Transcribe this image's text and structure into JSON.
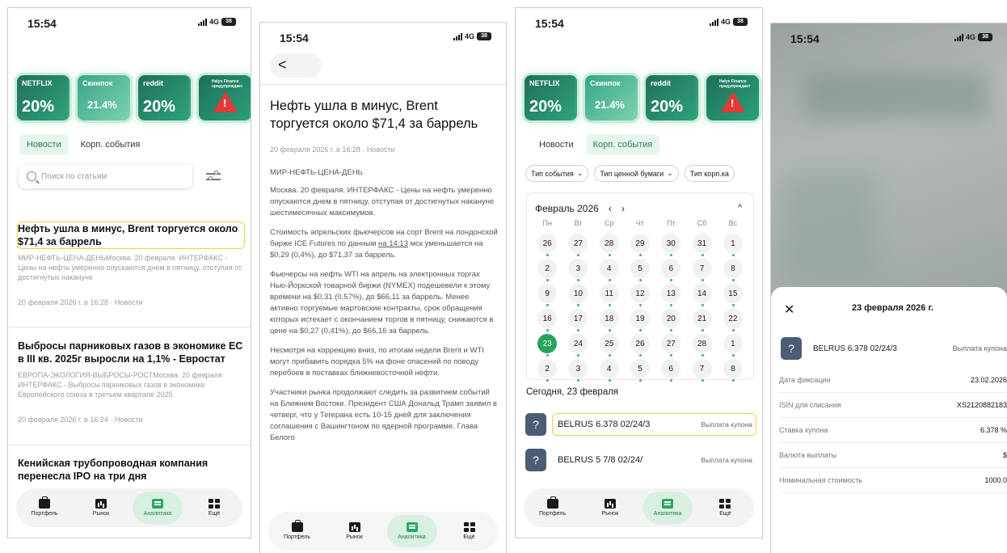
{
  "status": {
    "time": "15:54",
    "network": "4G",
    "battery": "38"
  },
  "promos": [
    {
      "brand": "NETFLIX",
      "value": "20%"
    },
    {
      "brand": "Cкинпок",
      "value": "21.4%"
    },
    {
      "brand": "reddit",
      "value": "20%"
    },
    {
      "brand": "Halys Finance предупреждает"
    }
  ],
  "tabs": {
    "news": "Новости",
    "corp": "Корп. события"
  },
  "search": {
    "placeholder": "Поиск по статьям"
  },
  "news": [
    {
      "title": "Нефть ушла в минус, Brent торгуется около $71,4 за баррель",
      "summary": "МИР-НЕФТЬ-ЦЕНА-ДЕНЬМосква. 20 февраля. ИНТЕРФАКС - Цены на нефть умеренно опускаются днем в пятницу, отступая от достигнутых накануне",
      "date": "20 февраля 2026 г. в 16:28 · Новости"
    },
    {
      "title": "Выбросы парниковых газов в экономике ЕС в III кв. 2025г выросли на 1,1% - Евростат",
      "summary": "ЕВРОПА-ЭКОЛОГИЯ-ВЫБРОСЫ-РОСТМосква. 20 февраля. ИНТЕРФАКС - Выбросы парниковых газов в экономике Европейского союза в третьем квартале 2025",
      "date": "20 февраля 2026 г. в 16:24 · Новости"
    },
    {
      "title": "Кенийская трубопроводная компания перенесла IPO на три дня"
    }
  ],
  "nav": {
    "portfolio": "Портфель",
    "market": "Рынок",
    "analytics": "Аналитика",
    "more": "Ещё"
  },
  "article": {
    "back": "<",
    "title": "Нефть ушла в минус, Brent торгуется около $71,4 за баррель",
    "meta": "20 февраля 2026 г. в 16:28 · Новости",
    "tag": "МИР-НЕФТЬ-ЦЕНА-ДЕНЬ",
    "p1": "Москва. 20 февраля. ИНТЕРФАКС - Цены на нефть умеренно опускаются днем в пятницу, отступая от достигнутых накануне шестимесячных максимумов.",
    "p2a": "Стоимость апрельских фьючерсов на сорт Brent на лондонской бирже ICE Futures по данным ",
    "p2link": "на 14:13",
    "p2b": " мск уменьшается на $0,29 (0,4%), до $71,37 за баррель.",
    "p3": "Фьючерсы на нефть WTI на апрель на электронных торгах Нью-Йоркской товарной биржи (NYMEX) подешевели к этому времени на $0,31 (0,57%), до $66,11 за баррель. Менее активно торгуемые мартовские контракты, срок обращения которых истекает с окончанием торгов в пятницу, снижаются в цене на $0,27 (0,41%), до $66,16 за баррель.",
    "p4": "Несмотря на коррекцию вниз, по итогам недели Brent и WTI могут прибавить порядка 5% на фоне опасений по поводу перебоев в поставках ближневосточной нефти.",
    "p5": "Участники рынка продолжают следить за развитием событий на Ближнем Востоке. Президент США Дональд Трамп заявил в четверг, что у Тегерана есть 10-15 дней для заключения соглашения с Вашингтоном по ядерной программе. Глава Белого"
  },
  "filters": [
    "Тип события",
    "Тип ценной бумаги",
    "Тип корп.ка"
  ],
  "calendar": {
    "month": "Февраль 2026",
    "weekdays": [
      "Пн",
      "Вт",
      "Ср",
      "Чт",
      "Пт",
      "Сб",
      "Вс"
    ],
    "days": [
      "26",
      "27",
      "28",
      "29",
      "30",
      "31",
      "1",
      "2",
      "3",
      "4",
      "5",
      "6",
      "7",
      "8",
      "9",
      "10",
      "11",
      "12",
      "13",
      "14",
      "15",
      "16",
      "17",
      "18",
      "19",
      "20",
      "21",
      "22",
      "23",
      "24",
      "25",
      "26",
      "27",
      "28",
      "1",
      "2",
      "3",
      "4",
      "5",
      "6",
      "7",
      "8"
    ],
    "selected": "23"
  },
  "today": "Сегодня, 23 февраля",
  "events": [
    {
      "name": "BELRUS 6.378 02/24/3",
      "type": "Выплата купона"
    },
    {
      "name": "BELRUS 5 7/8 02/24/",
      "type": "Выплата купона"
    }
  ],
  "sheet": {
    "title": "23 февраля 2026 г.",
    "event_name": "BELRUS 6.378 02/24/3",
    "event_type": "Выплата купона",
    "rows": [
      {
        "k": "Дата фиксации",
        "v": "23.02.2026"
      },
      {
        "k": "ISIN для списания",
        "v": "XS2120882183"
      },
      {
        "k": "Ставка купона",
        "v": "6.378 %"
      },
      {
        "k": "Валюта выплаты",
        "v": "$"
      },
      {
        "k": "Номинальная стоимость",
        "v": "1000.0"
      }
    ]
  }
}
